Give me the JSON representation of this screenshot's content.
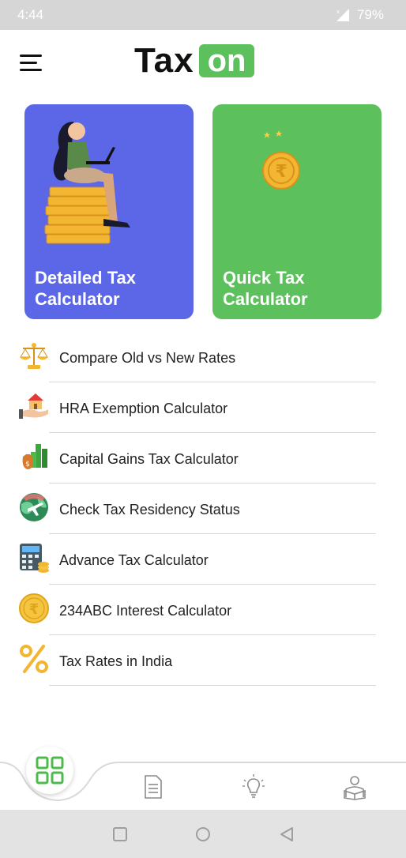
{
  "status_bar": {
    "time": "4:44",
    "battery": "79%",
    "icons": [
      "signal-icon",
      "battery-icon"
    ]
  },
  "header": {
    "logo_text_1": "Tax",
    "logo_text_2": "on",
    "menu_icon": "hamburger-menu-icon"
  },
  "cards": [
    {
      "label": "Detailed Tax Calculator",
      "color": "#5b67e6",
      "icon": "woman-on-coins-illustration"
    },
    {
      "label": "Quick Tax Calculator",
      "color": "#5cc05c",
      "icon": "rupee-coin-illustration"
    }
  ],
  "menu": [
    {
      "label": "Compare Old vs New Rates",
      "icon": "balance-scale-icon"
    },
    {
      "label": "HRA Exemption Calculator",
      "icon": "house-in-hand-icon"
    },
    {
      "label": "Capital Gains Tax Calculator",
      "icon": "money-bag-icon"
    },
    {
      "label": "Check Tax Residency Status",
      "icon": "globe-plane-icon"
    },
    {
      "label": "Advance Tax Calculator",
      "icon": "calculator-coins-icon"
    },
    {
      "label": "234ABC Interest Calculator",
      "icon": "rupee-coin-icon"
    },
    {
      "label": "Tax Rates in India",
      "icon": "percent-icon"
    }
  ],
  "bottom_nav": [
    "grid-home-icon",
    "document-list-icon",
    "lightbulb-icon",
    "person-reading-icon"
  ],
  "system_nav": [
    "recents-square-icon",
    "home-circle-icon",
    "back-triangle-icon"
  ],
  "colors": {
    "brand_green": "#5cc05c",
    "brand_blue": "#5b67e6",
    "status_bar": "#d6d6d6"
  }
}
